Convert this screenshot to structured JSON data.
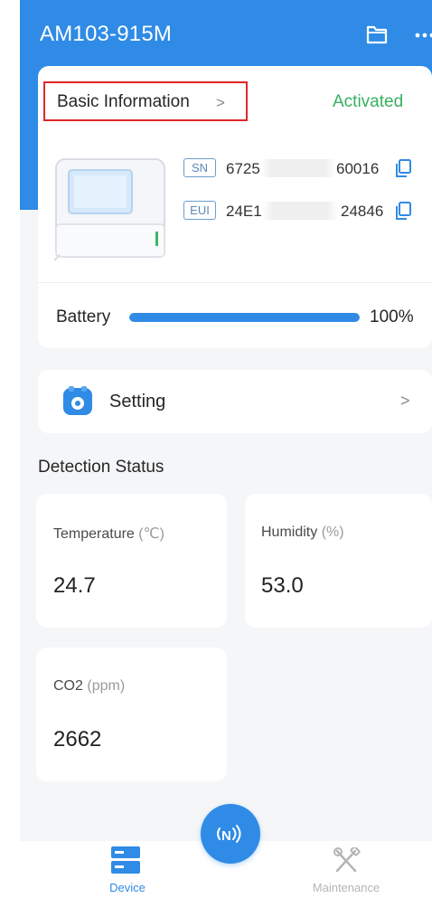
{
  "header": {
    "title": "AM103-915M",
    "icons": [
      "folder-icon",
      "more-icon"
    ]
  },
  "info": {
    "basic_info_label": "Basic Information",
    "chevron": ">",
    "status": "Activated",
    "sn": {
      "tag": "SN",
      "prefix": "6725",
      "suffix": "60016"
    },
    "eui": {
      "tag": "EUI",
      "prefix": "24E1",
      "suffix": "24846"
    }
  },
  "battery": {
    "label": "Battery",
    "value": "100%",
    "level_percent": 100
  },
  "setting": {
    "label": "Setting",
    "chevron": ">"
  },
  "detection": {
    "title": "Detection Status",
    "metrics": [
      {
        "label": "Temperature",
        "unit": "(℃)",
        "value": "24.7"
      },
      {
        "label": "Humidity",
        "unit": "(%)",
        "value": "53.0"
      },
      {
        "label": "CO2",
        "unit": "(ppm)",
        "value": "2662"
      }
    ]
  },
  "tabbar": {
    "device_label": "Device",
    "maintenance_label": "Maintenance"
  },
  "colors": {
    "primary": "#2f8be6",
    "activated": "#38b061",
    "highlight_border": "#e0262a"
  }
}
